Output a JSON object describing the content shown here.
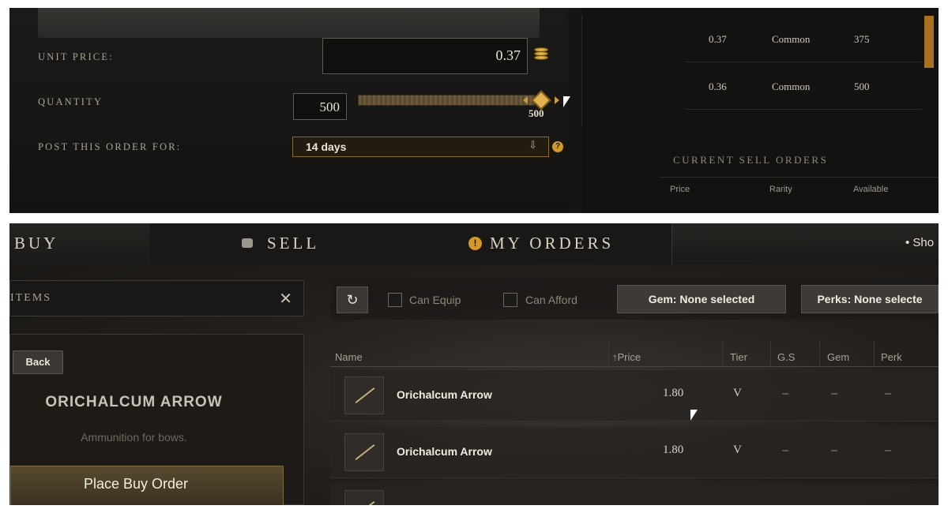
{
  "top": {
    "unit_price_label": "UNIT PRICE:",
    "unit_price_value": "0.37",
    "quantity_label": "QUANTITY",
    "quantity_value": "500",
    "slider_value": "500",
    "slider_fraction": 1.0,
    "post_label": "POST THIS ORDER FOR:",
    "post_value": "14 days",
    "help_icon": "?",
    "buy_orders_rows": [
      {
        "price": "0.37",
        "rarity": "Common",
        "quantity": "375"
      },
      {
        "price": "0.36",
        "rarity": "Common",
        "quantity": "500"
      }
    ],
    "sell_orders_title": "CURRENT SELL ORDERS",
    "sell_orders_headers": [
      "Price",
      "Rarity",
      "Available"
    ]
  },
  "bottom": {
    "tabs": [
      {
        "label": "BUY",
        "icon": "none"
      },
      {
        "label": "SELL",
        "icon": "coins-icon"
      },
      {
        "label": "MY ORDERS",
        "icon": "alert-icon"
      }
    ],
    "tab_more": "• Sho",
    "search_label": "ITEMS",
    "back_label": "Back",
    "item_title": "ORICHALCUM ARROW",
    "item_desc": "Ammunition for bows.",
    "place_buy_order_label": "Place Buy Order",
    "filters": {
      "can_equip": "Can Equip",
      "can_afford": "Can Afford",
      "gem": "Gem: None selected",
      "perks": "Perks: None selecte"
    },
    "columns": [
      "Name",
      "Price",
      "Tier",
      "G.S",
      "Gem",
      "Perk"
    ],
    "rows": [
      {
        "name": "Orichalcum Arrow",
        "price": "1.80",
        "tier": "V",
        "gs": "–",
        "gem": "–",
        "perk": "–"
      },
      {
        "name": "Orichalcum Arrow",
        "price": "1.80",
        "tier": "V",
        "gs": "–",
        "gem": "–",
        "perk": "–"
      }
    ]
  },
  "colors": {
    "accent_gold": "#d29a2a",
    "panel_dark": "#161513",
    "text_light": "#e9e4d6"
  }
}
